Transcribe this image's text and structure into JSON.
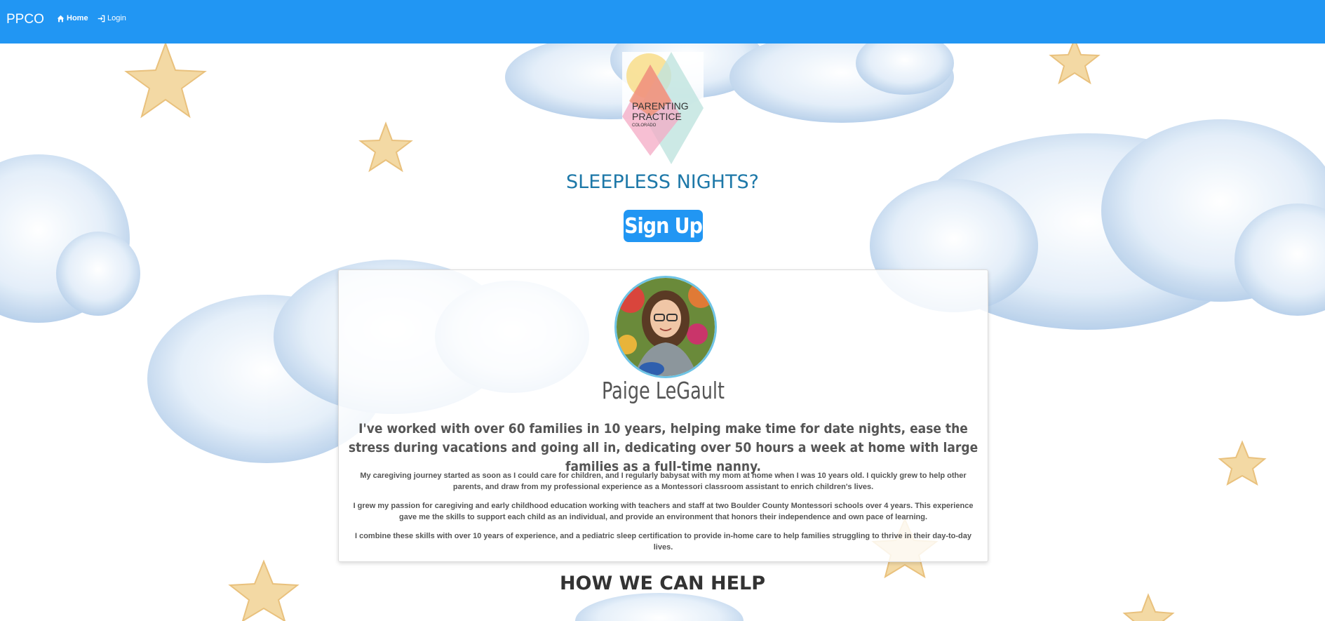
{
  "navbar": {
    "brand": "PPCO",
    "links": [
      {
        "label": "Home",
        "icon": "home-icon"
      },
      {
        "label": "Login",
        "icon": "sign-in-icon"
      }
    ],
    "background_color": "#2196f3"
  },
  "logo": {
    "lines": [
      "PARENTING",
      "PRACTICE",
      "COLORADO"
    ]
  },
  "hero": {
    "headline": "SLEEPLESS NIGHTS?",
    "signup_label": "Sign Up"
  },
  "profile": {
    "name": "Paige LeGault",
    "lead": "I've worked with over 60 families in 10 years, helping make time for date nights, ease the stress during vacations and going all in, dedicating over 50 hours a week at home with large families as a full-time nanny.",
    "paragraphs": [
      "My caregiving journey started as soon as I could care for children, and I regularly babysat with my mom at home when I was 10 years old. I quickly grew to help other parents, and draw from my professional experience as a Montessori classroom assistant to enrich children's lives.",
      "I grew my passion for caregiving and early childhood education working with teachers and staff at two Boulder County Montessori schools over 4 years. This experience gave me the skills to support each child as an individual, and provide an environment that honors their independence and own pace of learning.",
      "I combine these skills with over 10 years of experience, and a pediatric sleep certification to provide in-home care to help families struggling to thrive in their day-to-day lives."
    ]
  },
  "section": {
    "title": "HOW WE CAN HELP"
  },
  "colors": {
    "accent": "#2196f3",
    "headline": "#1d78a8",
    "cloud": "#c9dff2",
    "star": "#f3d9a4"
  }
}
